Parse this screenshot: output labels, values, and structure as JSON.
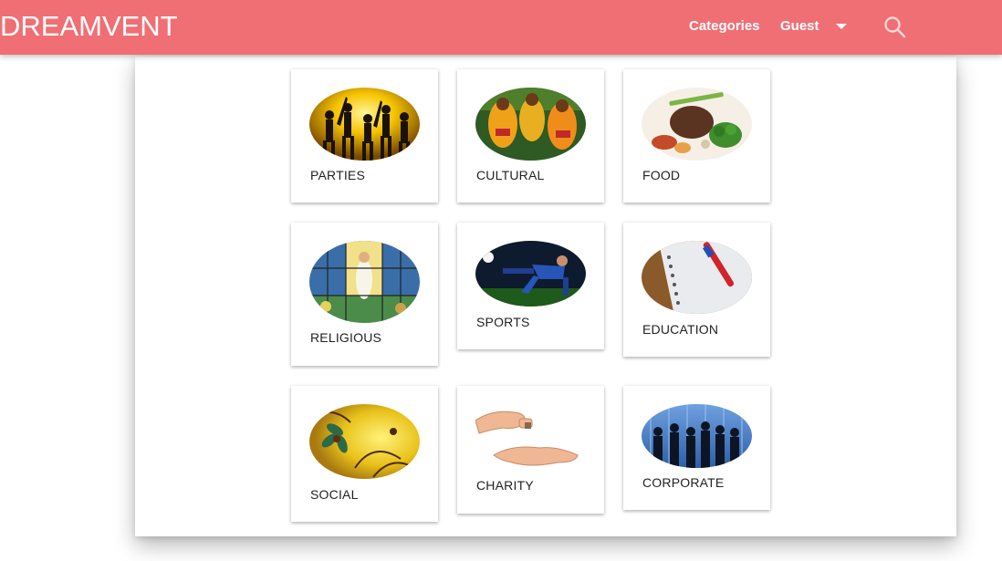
{
  "header": {
    "brand": "DREAMVENT",
    "nav": {
      "categories": "Categories",
      "guest": "Guest"
    },
    "icons": {
      "dropdown": "caret-down-icon",
      "search": "search-icon"
    },
    "colors": {
      "bar": "#ef6f74",
      "text": "#ffffff"
    }
  },
  "categories": [
    {
      "label": "PARTIES"
    },
    {
      "label": "CULTURAL"
    },
    {
      "label": "FOOD"
    },
    {
      "label": "RELIGIOUS"
    },
    {
      "label": "SPORTS"
    },
    {
      "label": "EDUCATION"
    },
    {
      "label": "SOCIAL"
    },
    {
      "label": "CHARITY"
    },
    {
      "label": "CORPORATE"
    }
  ]
}
